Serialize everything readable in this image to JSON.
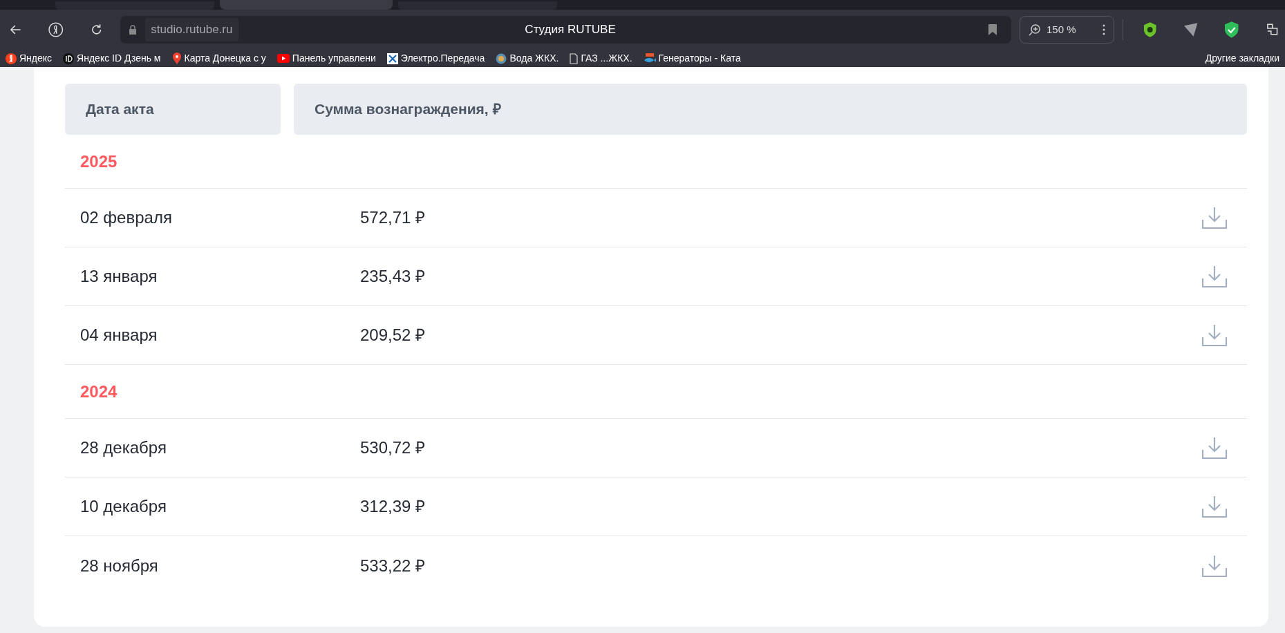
{
  "browser": {
    "tabs": [
      {
        "selected": false
      },
      {
        "selected": true
      },
      {
        "selected": false
      }
    ],
    "url": "studio.rutube.ru",
    "page_title": "Студия RUTUBE",
    "zoom": "150 %",
    "bookmarks": [
      {
        "label": "Яндекс",
        "kind": "yandex"
      },
      {
        "label": "Яндекс ID Дзень м",
        "kind": "id"
      },
      {
        "label": "Карта Донецка с у",
        "kind": "pin"
      },
      {
        "label": "Панель управлени",
        "kind": "video"
      },
      {
        "label": "Электро.Передача",
        "kind": "tile"
      },
      {
        "label": "Вода  ЖКХ.",
        "kind": "globe"
      },
      {
        "label": "ГАЗ ...ЖКХ.",
        "kind": "page"
      },
      {
        "label": "Генераторы - Ката",
        "kind": "fish"
      }
    ],
    "other_bookmarks": "Другие закладки"
  },
  "table": {
    "columns": [
      "Дата акта",
      "Сумма вознаграждения, ₽"
    ],
    "groups": [
      {
        "year": "2025",
        "rows": [
          {
            "date": "02 февраля",
            "amount": "572,71 ₽"
          },
          {
            "date": "13 января",
            "amount": "235,43 ₽"
          },
          {
            "date": "04 января",
            "amount": "209,52 ₽"
          }
        ]
      },
      {
        "year": "2024",
        "rows": [
          {
            "date": "28 декабря",
            "amount": "530,72 ₽"
          },
          {
            "date": "10 декабря",
            "amount": "312,39 ₽"
          },
          {
            "date": "28 ноября",
            "amount": "533,22 ₽"
          }
        ]
      }
    ]
  }
}
